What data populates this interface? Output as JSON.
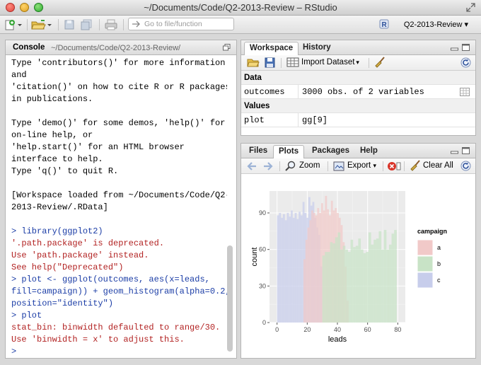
{
  "window": {
    "title": "~/Documents/Code/Q2-2013-Review – RStudio"
  },
  "toolbar": {
    "goto_placeholder": "Go to file/function",
    "project": "Q2-2013-Review"
  },
  "console": {
    "title": "Console",
    "path": "~/Documents/Code/Q2-2013-Review/",
    "lines": [
      {
        "t": "Type 'contributors()' for more information",
        "c": "out"
      },
      {
        "t": "and",
        "c": "out"
      },
      {
        "t": "'citation()' on how to cite R or R packages",
        "c": "out"
      },
      {
        "t": "in publications.",
        "c": "out"
      },
      {
        "t": "",
        "c": "out"
      },
      {
        "t": "Type 'demo()' for some demos, 'help()' for",
        "c": "out"
      },
      {
        "t": "on-line help, or",
        "c": "out"
      },
      {
        "t": "'help.start()' for an HTML browser",
        "c": "out"
      },
      {
        "t": "interface to help.",
        "c": "out"
      },
      {
        "t": "Type 'q()' to quit R.",
        "c": "out"
      },
      {
        "t": "",
        "c": "out"
      },
      {
        "t": "[Workspace loaded from ~/Documents/Code/Q2-",
        "c": "out"
      },
      {
        "t": "2013-Review/.RData]",
        "c": "out"
      },
      {
        "t": "",
        "c": "out"
      },
      {
        "t": "> library(ggplot2)",
        "c": "cmd"
      },
      {
        "t": "'.path.package' is deprecated.",
        "c": "err"
      },
      {
        "t": "Use 'path.package' instead.",
        "c": "err"
      },
      {
        "t": "See help(\"Deprecated\")",
        "c": "err"
      },
      {
        "t": "> plot <- ggplot(outcomes, aes(x=leads,",
        "c": "cmd"
      },
      {
        "t": "fill=campaign)) + geom_histogram(alpha=0.2,",
        "c": "cmd"
      },
      {
        "t": "position=\"identity\")",
        "c": "cmd"
      },
      {
        "t": "> plot",
        "c": "cmd"
      },
      {
        "t": "stat_bin: binwidth defaulted to range/30.",
        "c": "err"
      },
      {
        "t": "Use 'binwidth = x' to adjust this.",
        "c": "err"
      },
      {
        "t": ">",
        "c": "cmd"
      }
    ]
  },
  "workspace": {
    "tabs": [
      "Workspace",
      "History"
    ],
    "import_label": "Import Dataset",
    "sections": [
      {
        "title": "Data",
        "rows": [
          {
            "name": "outcomes",
            "value": "3000 obs. of 2 variables"
          }
        ]
      },
      {
        "title": "Values",
        "rows": [
          {
            "name": "plot",
            "value": "gg[9]"
          }
        ]
      }
    ]
  },
  "plots": {
    "tabs": [
      "Files",
      "Plots",
      "Packages",
      "Help"
    ],
    "zoom_label": "Zoom",
    "export_label": "Export",
    "clear_label": "Clear All"
  },
  "colors": {
    "a": "#f1c9c8",
    "b": "#c8e3c6",
    "c": "#c7cdeb",
    "plot_bg": "#ebebeb",
    "grid": "#ffffff"
  },
  "chart_data": {
    "type": "bar",
    "title": "",
    "xlabel": "leads",
    "ylabel": "count",
    "xlim": [
      -5,
      85
    ],
    "ylim": [
      0,
      108
    ],
    "xticks": [
      0,
      20,
      40,
      60,
      80
    ],
    "yticks": [
      0,
      30,
      60,
      90
    ],
    "grid": true,
    "legend": {
      "title": "campaign",
      "placement": "right"
    },
    "series": [
      {
        "name": "c",
        "x0": [
          0,
          1.3,
          2.6,
          3.9,
          5.2,
          6.5,
          7.8,
          9.1,
          10.4,
          11.7,
          13.0,
          14.3,
          15.6,
          16.9,
          18.2,
          19.5,
          20.8,
          22.1,
          23.4,
          24.7,
          26.0,
          27.3,
          28.6
        ],
        "x1": [
          1.3,
          2.6,
          3.9,
          5.2,
          6.5,
          7.8,
          9.1,
          10.4,
          11.7,
          13.0,
          14.3,
          15.6,
          16.9,
          18.2,
          19.5,
          20.8,
          22.1,
          23.4,
          24.7,
          26.0,
          27.3,
          28.6,
          30.0
        ],
        "values": [
          88,
          90,
          86,
          89,
          84,
          90,
          87,
          92,
          86,
          90,
          85,
          91,
          88,
          99,
          90,
          86,
          103,
          96,
          99,
          86,
          78,
          72,
          46
        ]
      },
      {
        "name": "a",
        "x0": [
          17.5,
          18.8,
          20.1,
          21.4,
          22.7,
          24.0,
          25.3,
          26.6,
          27.9,
          29.2,
          30.5,
          31.8,
          33.1,
          34.4,
          35.7,
          37.0,
          38.3,
          39.6,
          40.9,
          42.2,
          43.5,
          44.8,
          46.1
        ],
        "x1": [
          18.8,
          20.1,
          21.4,
          22.7,
          24.0,
          25.3,
          26.6,
          27.9,
          29.2,
          30.5,
          31.8,
          33.1,
          34.4,
          35.7,
          37.0,
          38.3,
          39.6,
          40.9,
          42.2,
          43.5,
          44.8,
          46.1,
          47.5
        ],
        "values": [
          52,
          68,
          78,
          84,
          92,
          90,
          88,
          94,
          90,
          98,
          92,
          104,
          93,
          88,
          100,
          92,
          94,
          90,
          86,
          80,
          66,
          46,
          18
        ]
      },
      {
        "name": "b",
        "x0": [
          30.0,
          31.7,
          33.4,
          35.1,
          36.8,
          38.5,
          40.2,
          41.9,
          43.6,
          45.3,
          47.0,
          48.7,
          50.4,
          52.1,
          53.8,
          55.5,
          57.2,
          58.9,
          60.6,
          62.3,
          64.0,
          65.7,
          67.4,
          69.1,
          70.8,
          72.5,
          74.2,
          75.9,
          77.6
        ],
        "x1": [
          31.7,
          33.4,
          35.1,
          36.8,
          38.5,
          40.2,
          41.9,
          43.6,
          45.3,
          47.0,
          48.7,
          50.4,
          52.1,
          53.8,
          55.5,
          57.2,
          58.9,
          60.6,
          62.3,
          64.0,
          65.7,
          67.4,
          69.1,
          70.8,
          72.5,
          74.2,
          75.9,
          77.6,
          79.3
        ],
        "values": [
          55,
          58,
          58,
          66,
          65,
          70,
          74,
          60,
          63,
          60,
          58,
          68,
          62,
          63,
          69,
          60,
          57,
          58,
          74,
          64,
          68,
          69,
          75,
          60,
          76,
          60,
          64,
          73,
          76
        ]
      }
    ]
  }
}
